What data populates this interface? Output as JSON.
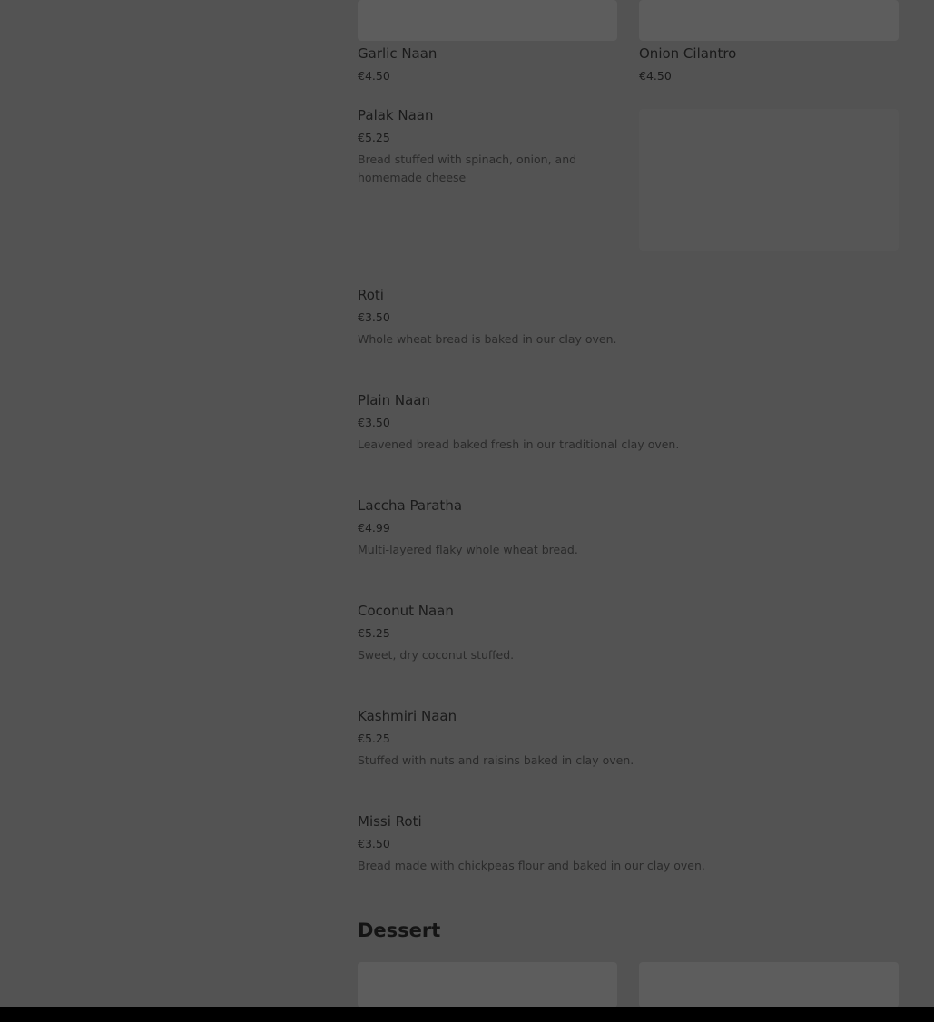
{
  "grid_items": [
    {
      "name": "Garlic Naan",
      "price": "€4.50"
    },
    {
      "name": "Onion Cilantro",
      "price": "€4.50"
    },
    {
      "name": "Palak Naan",
      "price": "€5.25",
      "description": "Bread stuffed with spinach, onion, and homemade cheese"
    }
  ],
  "list_items": [
    {
      "name": "Roti",
      "price": "€3.50",
      "description": "Whole wheat bread is baked in our clay oven."
    },
    {
      "name": "Plain Naan",
      "price": "€3.50",
      "description": "Leavened bread baked fresh in our traditional clay oven."
    },
    {
      "name": "Laccha Paratha",
      "price": "€4.99",
      "description": "Multi-layered flaky whole wheat bread."
    },
    {
      "name": "Coconut Naan",
      "price": "€5.25",
      "description": "Sweet, dry coconut stuffed."
    },
    {
      "name": "Kashmiri Naan",
      "price": "€5.25",
      "description": "Stuffed with nuts and raisins baked in clay oven."
    },
    {
      "name": "Missi Roti",
      "price": "€3.50",
      "description": "Bread made with chickpeas flour and baked in our clay oven."
    }
  ],
  "dessert_section": {
    "title": "Dessert"
  },
  "colors": {
    "overlay_background": "#535353",
    "text_dark": "#1a1a1a",
    "bottom_bar": "#000000"
  }
}
